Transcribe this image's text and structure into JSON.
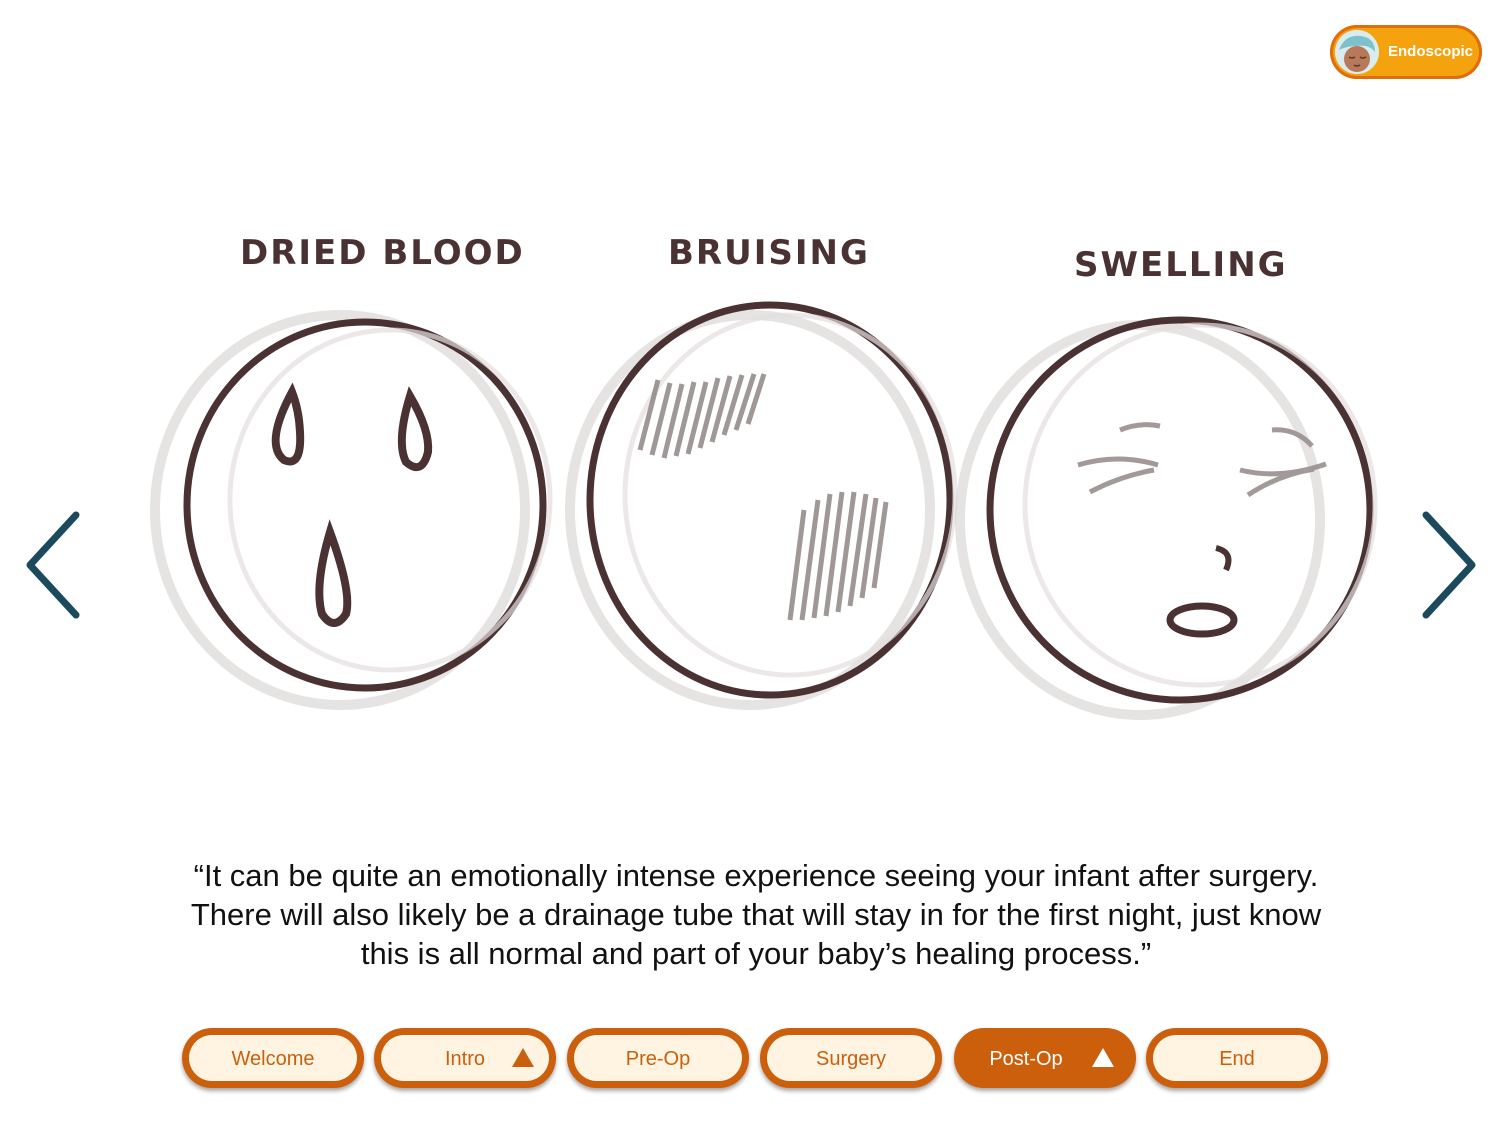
{
  "badge": {
    "label": "Endoscopic",
    "color": "#f4a20e"
  },
  "illustration": {
    "labels": [
      "DRIED BLOOD",
      "BRUISING",
      "SWELLING"
    ]
  },
  "navigation": {
    "prev_icon": "chevron-left-icon",
    "next_icon": "chevron-right-icon",
    "color": "#1b4a5c"
  },
  "caption": {
    "lines": [
      "“It can be quite an emotionally intense experience seeing your infant after surgery.",
      "There will also likely be a drainage tube that will stay in for the first night, just know",
      "this is all normal and part of your baby’s healing process.”"
    ]
  },
  "tabs": [
    {
      "label": "Welcome",
      "active": false,
      "has_indicator": false
    },
    {
      "label": "Intro",
      "active": false,
      "has_indicator": true
    },
    {
      "label": "Pre-Op",
      "active": false,
      "has_indicator": false
    },
    {
      "label": "Surgery",
      "active": false,
      "has_indicator": false
    },
    {
      "label": "Post-Op",
      "active": true,
      "has_indicator": true
    },
    {
      "label": "End",
      "active": false,
      "has_indicator": false
    }
  ],
  "colors": {
    "accent": "#cc5f0c",
    "tab_fill": "#fff4e2",
    "sketch": "#4b3232"
  }
}
